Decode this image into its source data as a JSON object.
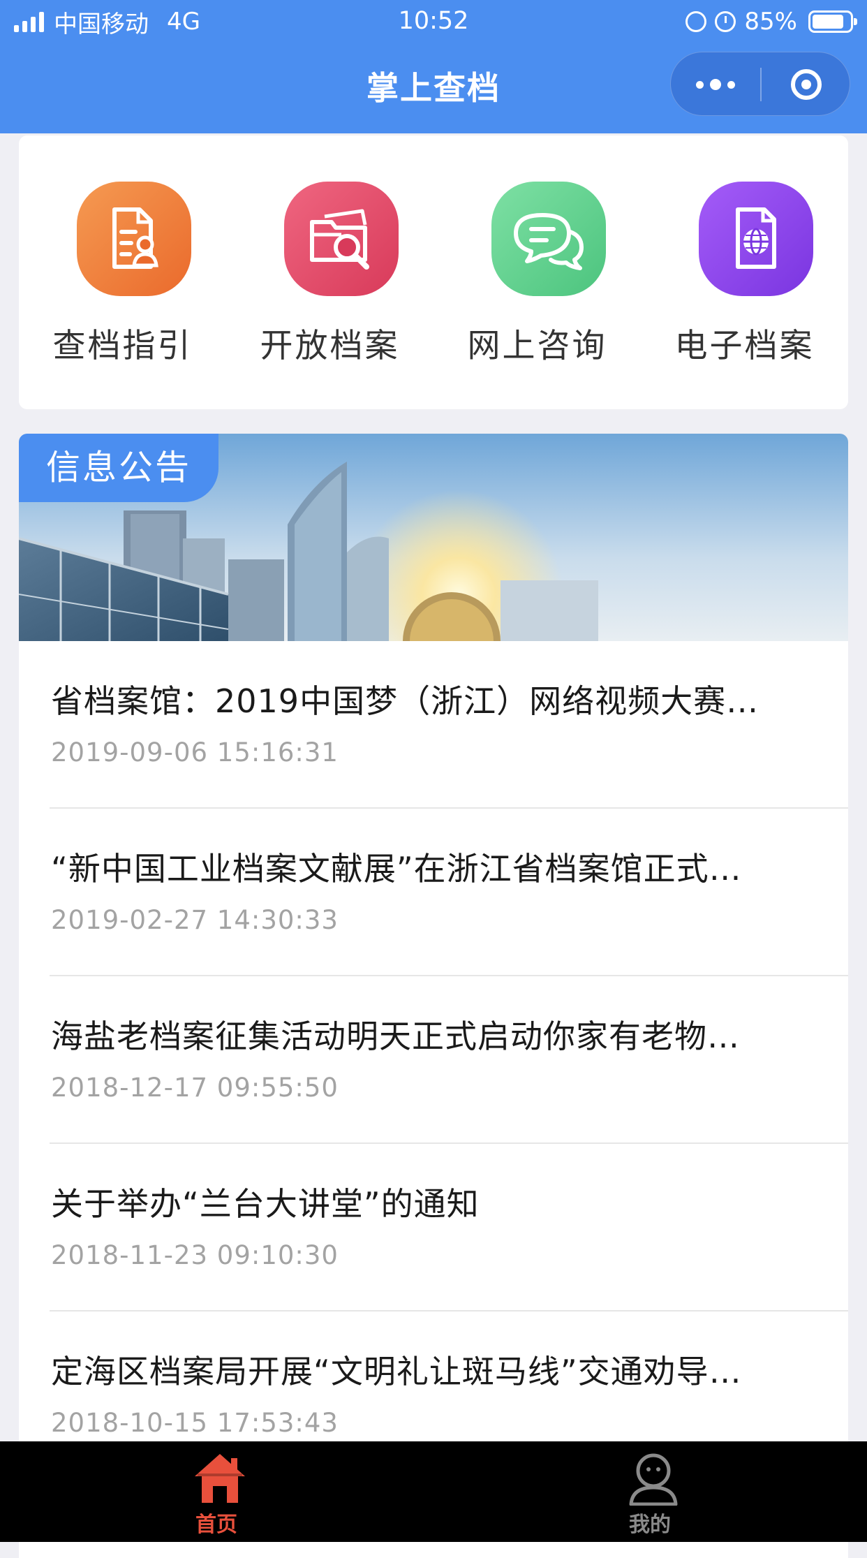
{
  "status_bar": {
    "carrier": "中国移动",
    "network": "4G",
    "time": "10:52",
    "battery_percent": "85%",
    "battery_level": 0.85
  },
  "nav": {
    "title": "掌上查档",
    "more_icon": "ellipsis-icon",
    "close_icon": "target-circle-icon"
  },
  "menu": [
    {
      "label": "查档指引",
      "icon": "document-person-icon",
      "color": "#ef7a3a"
    },
    {
      "label": "开放档案",
      "icon": "folder-search-icon",
      "color": "#e64d6a"
    },
    {
      "label": "网上咨询",
      "icon": "chat-bubbles-icon",
      "color": "#5ccf8a"
    },
    {
      "label": "电子档案",
      "icon": "globe-document-icon",
      "color": "#8f47ee"
    }
  ],
  "notice": {
    "tag": "信息公告",
    "items": [
      {
        "title": "省档案馆：2019中国梦（浙江）网络视频大赛…",
        "date": "2019-09-06 15:16:31"
      },
      {
        "title": "“新中国工业档案文献展”在浙江省档案馆正式…",
        "date": "2019-02-27 14:30:33"
      },
      {
        "title": "海盐老档案征集活动明天正式启动你家有老物…",
        "date": "2018-12-17 09:55:50"
      },
      {
        "title": "关于举办“兰台大讲堂”的通知",
        "date": "2018-11-23 09:10:30"
      },
      {
        "title": "定海区档案局开展“文明礼让斑马线”交通劝导…",
        "date": "2018-10-15 17:53:43"
      }
    ]
  },
  "tabbar": {
    "home": {
      "label": "首页",
      "icon": "home-icon",
      "color": "#e8503c"
    },
    "mine": {
      "label": "我的",
      "icon": "user-icon",
      "color": "#8a8a8a"
    }
  }
}
